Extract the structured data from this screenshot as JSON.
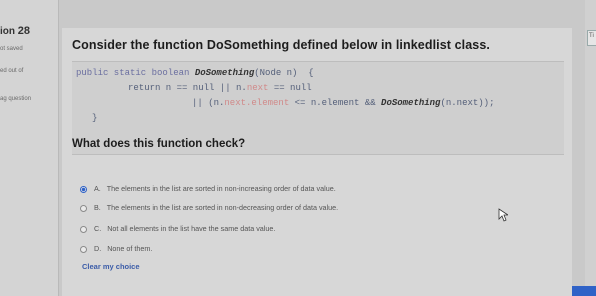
{
  "sidebar": {
    "question_label": "ion",
    "question_number": "28",
    "status": "ot saved",
    "marks": "ed out of",
    "flag": "ag question"
  },
  "question": {
    "title": "Consider the function DoSomething  defined below in linkedlist class.",
    "code": {
      "line1_kw": "public static boolean ",
      "line1_fn": "DoSomething",
      "line1_rest": "(Node n)  {",
      "line2": "return n == null || n.",
      "line2_ref": "next",
      "line2_rest": " == null",
      "line3_a": "|| (n.",
      "line3_ref": "next.element",
      "line3_b": " <= n.element && ",
      "line3_fn": "DoSomething",
      "line3_c": "(n.next));",
      "line4": "}"
    },
    "prompt": "What does this function check?",
    "options": [
      {
        "letter": "A.",
        "text": "The elements in the list are sorted in non-increasing order of data value."
      },
      {
        "letter": "B.",
        "text": "The elements in the list are sorted in non-decreasing order of data value."
      },
      {
        "letter": "C.",
        "text": "Not all elements in the list have the same data value."
      },
      {
        "letter": "D.",
        "text": "None of them."
      }
    ],
    "selected": "A.",
    "clear_label": "Clear my choice"
  },
  "right_panel": {
    "tab_label": "Ti"
  }
}
